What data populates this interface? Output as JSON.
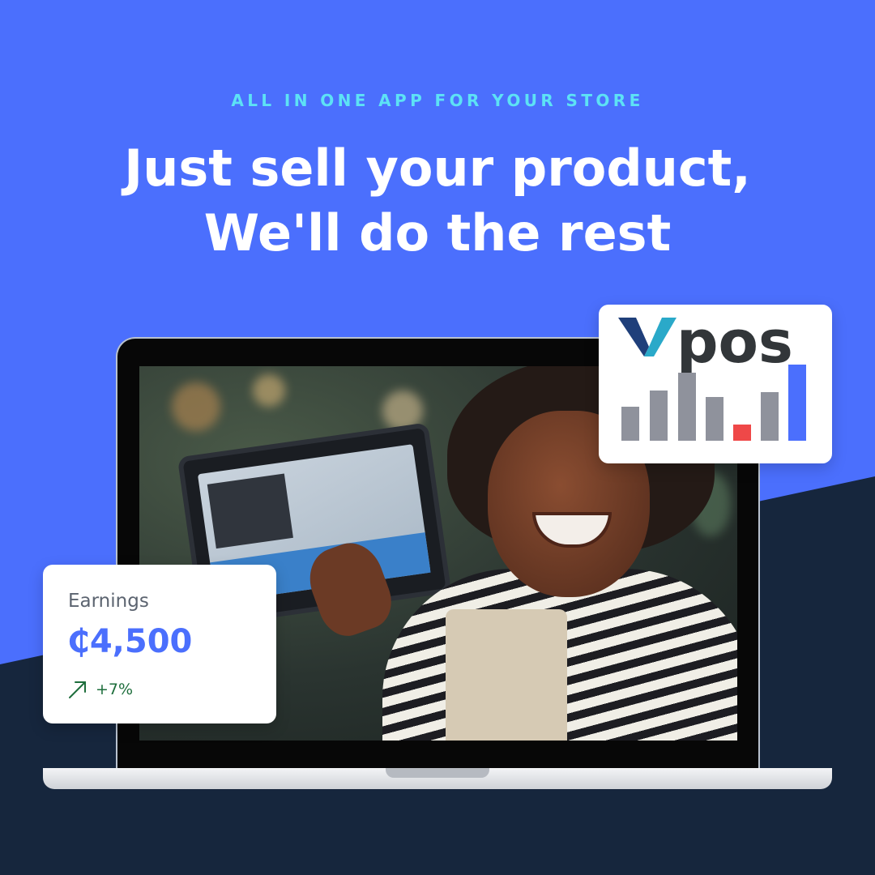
{
  "header": {
    "eyebrow": "ALL IN ONE APP FOR YOUR STORE",
    "headline_line1": "Just sell your product,",
    "headline_line2": "We'll do the rest"
  },
  "logo": {
    "text": "pos",
    "colors": {
      "v_dark": "#1f3f7a",
      "v_light": "#2aa9c9",
      "bar_gray": "#8f929c",
      "bar_red": "#ef4848",
      "bar_blue": "#4b6ffd"
    }
  },
  "earnings": {
    "label": "Earnings",
    "value": "₵4,500",
    "trend": "+7%",
    "trend_icon": "arrow-up-right-icon"
  },
  "colors": {
    "background_blue": "#4b6ffd",
    "background_navy": "#16263d",
    "eyebrow": "#5de2f5",
    "headline": "#ffffff"
  }
}
